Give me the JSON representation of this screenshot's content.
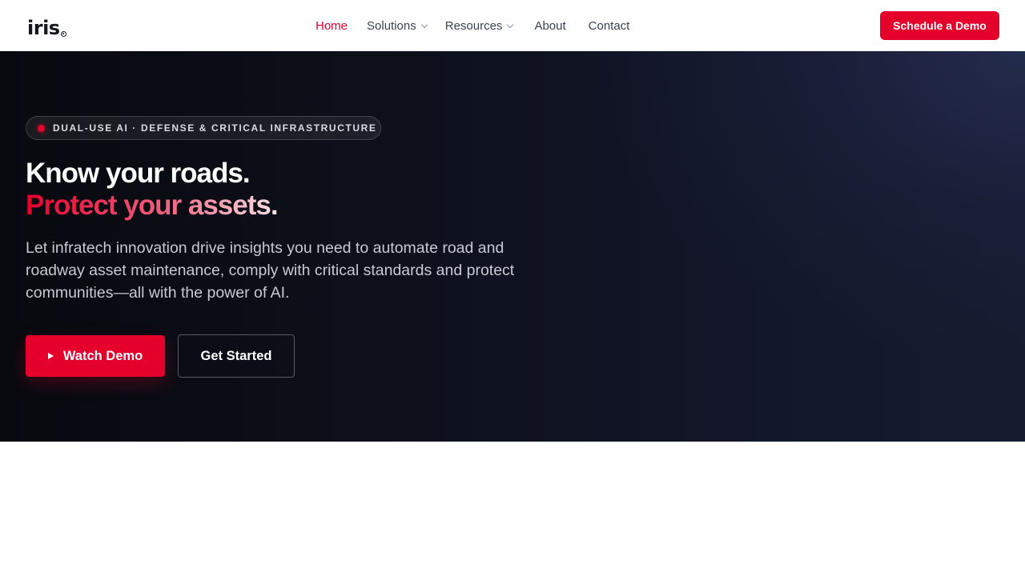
{
  "nav": {
    "logo_text": "iris",
    "links": [
      {
        "label": "Home",
        "active": true
      },
      {
        "label": "Solutions"
      },
      {
        "label": "Resources"
      },
      {
        "label": "About"
      },
      {
        "label": "Contact"
      }
    ],
    "cta_label": "Schedule a Demo"
  },
  "hero": {
    "badge": "DUAL-USE AI · DEFENSE & CRITICAL INFRASTRUCTURE",
    "headline_line1": "Know your roads.",
    "headline_line2": "Protect your assets.",
    "description": "Let infratech innovation drive insights you need to automate road and roadway asset maintenance, comply with critical standards and protect communities—all with the power of AI.",
    "primary_button": "Watch Demo",
    "secondary_button": "Get Started"
  },
  "colors": {
    "accent": "#e4002b",
    "hero_bg": "#0d0f1a",
    "nav_text": "#3b4150"
  },
  "icons": {
    "play": "play-icon",
    "dropdown": "chevron-down-icon"
  }
}
